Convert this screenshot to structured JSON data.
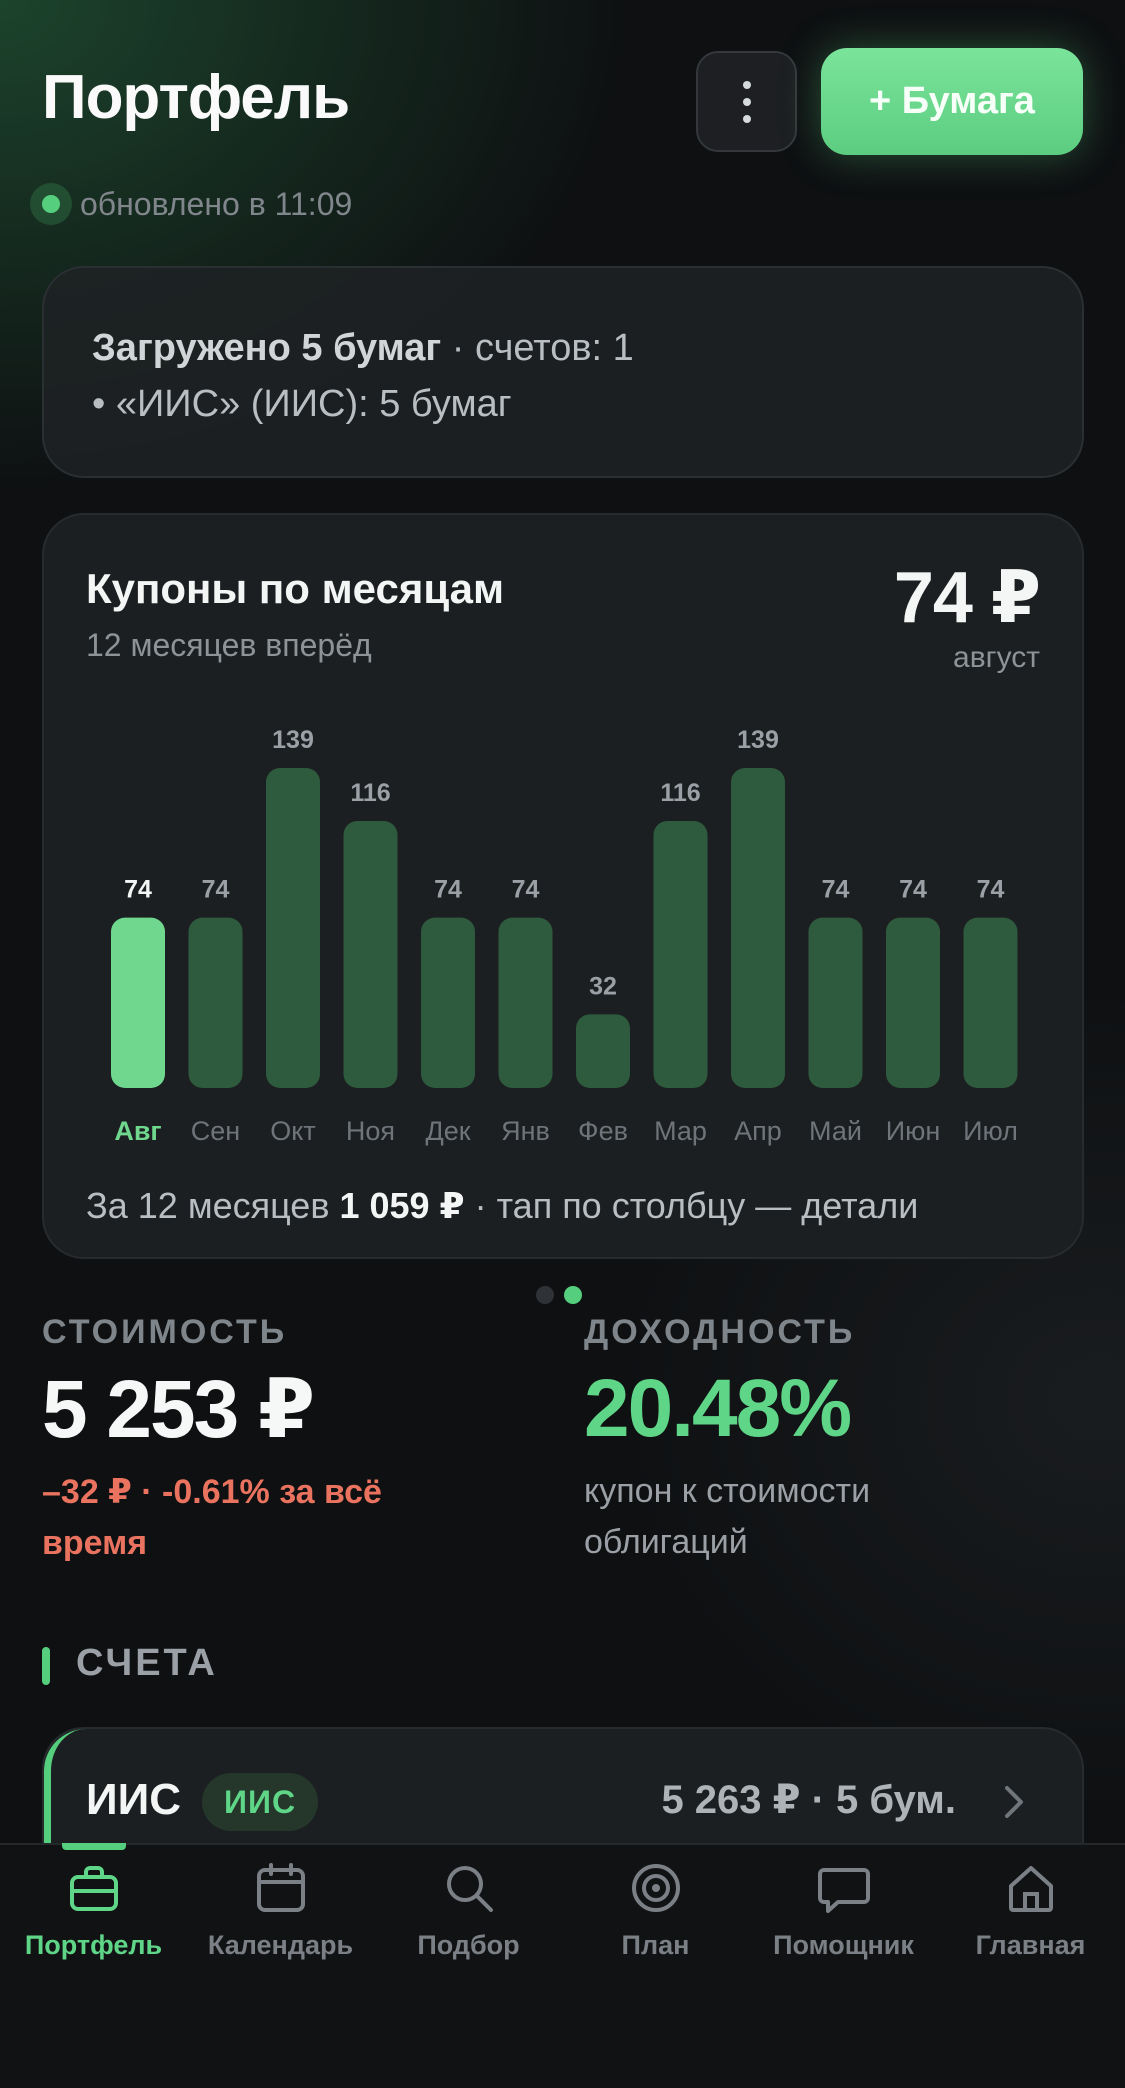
{
  "header": {
    "title": "Портфель",
    "add_button": "+ Бумага",
    "status": "обновлено в 11:09"
  },
  "info": {
    "loaded": "Загружено 5 бумаг",
    "accounts": " · счетов: 1",
    "line2": "• «ИИС» (ИИС): 5 бумаг"
  },
  "chart_card": {
    "title": "Купоны по месяцам",
    "subtitle": "12 месяцев вперёд",
    "big_value": "74 ₽",
    "big_label": "август",
    "footer_prefix": "За 12 месяцев ",
    "footer_total": "1 059 ₽",
    "footer_suffix": " · тап по столбцу — детали"
  },
  "chart_data": {
    "type": "bar",
    "categories": [
      "Авг",
      "Сен",
      "Окт",
      "Ноя",
      "Дек",
      "Янв",
      "Фев",
      "Мар",
      "Апр",
      "Май",
      "Июн",
      "Июл"
    ],
    "values": [
      74,
      74,
      139,
      116,
      74,
      74,
      32,
      116,
      139,
      74,
      74,
      74
    ],
    "selected_index": 0,
    "ylim": [
      0,
      139
    ],
    "grid": false,
    "colors": {
      "bar": "#2e5a3d",
      "selected": "#6fd88e"
    }
  },
  "stats": {
    "value_label": "СТОИМОСТЬ",
    "value": "5 253 ₽",
    "value_change": "–32 ₽ · -0.61% за всё время",
    "yield_label": "ДОХОДНОСТЬ",
    "yield": "20.48%",
    "yield_note": "купон к стоимости облигаций"
  },
  "accounts_section": {
    "title": "СЧЕТА",
    "items": [
      {
        "name": "ИИС",
        "badge": "ИИС",
        "summary": "5 263 ₽ · 5 бум."
      }
    ]
  },
  "nav": {
    "items": [
      {
        "label": "Портфель",
        "icon": "briefcase-icon",
        "active": true
      },
      {
        "label": "Календарь",
        "icon": "calendar-icon",
        "active": false
      },
      {
        "label": "Подбор",
        "icon": "search-icon",
        "active": false
      },
      {
        "label": "План",
        "icon": "target-icon",
        "active": false
      },
      {
        "label": "Помощник",
        "icon": "chat-icon",
        "active": false
      },
      {
        "label": "Главная",
        "icon": "home-icon",
        "active": false
      }
    ]
  },
  "colors": {
    "accent": "#55cf7d",
    "negative": "#e9735f",
    "background": "#0e1012"
  }
}
